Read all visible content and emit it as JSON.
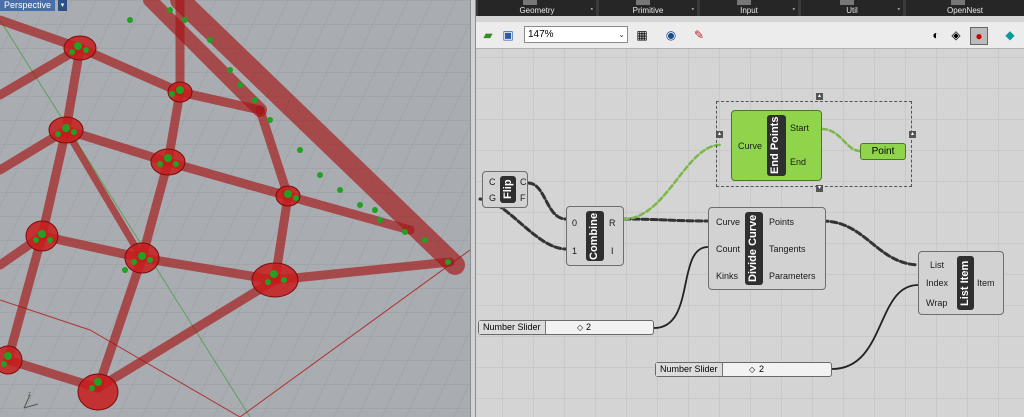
{
  "viewport": {
    "label": "Perspective",
    "arrow": "▾"
  },
  "ribbon": {
    "tabs": [
      "Geometry",
      "Primitive",
      "Input",
      "Util",
      "OpenNest"
    ],
    "more": "▪"
  },
  "toolbar": {
    "zoom": "147%",
    "dropdown": "⌄"
  },
  "components": {
    "flip": {
      "nick": "Flip",
      "in": [
        "C",
        "G"
      ],
      "out": [
        "C",
        "F"
      ]
    },
    "combine": {
      "nick": "Combine",
      "in": [
        "0",
        "1"
      ],
      "out": [
        "R",
        "I"
      ]
    },
    "divide": {
      "nick": "Divide Curve",
      "in": [
        "Curve",
        "Count",
        "Kinks"
      ],
      "out": [
        "Points",
        "Tangents",
        "Parameters"
      ]
    },
    "endpoints": {
      "nick": "End Points",
      "in": [
        "Curve"
      ],
      "out": [
        "Start",
        "End"
      ]
    },
    "point": {
      "label": "Point"
    },
    "listitem": {
      "nick": "List Item",
      "in": [
        "List",
        "Index",
        "Wrap"
      ],
      "out": [
        "Item"
      ]
    }
  },
  "sliders": [
    {
      "name": "Number Slider",
      "value": "2",
      "marker": "◇"
    },
    {
      "name": "Number Slider",
      "value": "2",
      "marker": "◇"
    }
  ],
  "icons": [
    "open-file-icon",
    "save-icon",
    "sketch-icon",
    "eye-icon",
    "paint-icon",
    "preview-icon",
    "wire-icon",
    "color-icon",
    "rhino-icon"
  ],
  "colors": {
    "canvas": "#d4d4d4",
    "component": "#d2d2d2",
    "selected": "#8fd44a",
    "viewport": "#a9adb1",
    "mesh": "#b01818",
    "points": "#1fa31f"
  }
}
